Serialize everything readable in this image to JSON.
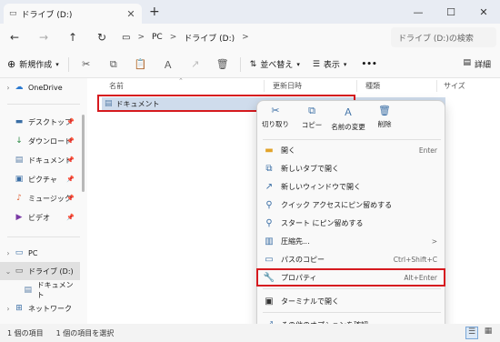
{
  "tab": {
    "title": "ドライブ (D:)",
    "close": "✕",
    "new": "+"
  },
  "window": {
    "minimize": "—",
    "maximize": "☐",
    "close": "✕"
  },
  "nav": {
    "back": "←",
    "forward": "→",
    "up": "↑",
    "refresh": "↻"
  },
  "breadcrumb": {
    "root_icon": "computer-icon",
    "items": [
      "PC",
      "ドライブ (D:)"
    ],
    "sep": ">"
  },
  "search": {
    "placeholder": "ドライブ (D:)の検索"
  },
  "toolbar": {
    "new_label": "新規作成",
    "sort_label": "並べ替え",
    "view_label": "表示",
    "more_label": "•••",
    "details_label": "詳細"
  },
  "sidebar": {
    "onedrive": "OneDrive",
    "quick": [
      "デスクトップ",
      "ダウンロード",
      "ドキュメント",
      "ピクチャ",
      "ミュージック",
      "ビデオ"
    ],
    "pc": "PC",
    "drive": "ドライブ (D:)",
    "drive_child": "ドキュメント",
    "network": "ネットワーク"
  },
  "columns": {
    "name": "名前",
    "date": "更新日時",
    "type": "種類",
    "size": "サイズ"
  },
  "files": [
    {
      "name": "ドキュメント"
    }
  ],
  "context_menu": {
    "top": {
      "cut": "切り取り",
      "copy": "コピー",
      "rename": "名前の変更",
      "delete": "削除"
    },
    "items": {
      "open": {
        "label": "開く",
        "shortcut": "Enter"
      },
      "open_tab": {
        "label": "新しいタブで開く"
      },
      "open_window": {
        "label": "新しいウィンドウで開く"
      },
      "pin_quick": {
        "label": "クイック アクセスにピン留めする"
      },
      "pin_start": {
        "label": "スタート にピン留めする"
      },
      "compress": {
        "label": "圧縮先...",
        "arrow": ">"
      },
      "copy_path": {
        "label": "パスのコピー",
        "shortcut": "Ctrl+Shift+C"
      },
      "properties": {
        "label": "プロパティ",
        "shortcut": "Alt+Enter"
      },
      "terminal": {
        "label": "ターミナルで開く"
      },
      "more_options": {
        "label": "その他のオプションを確認"
      }
    }
  },
  "status": {
    "count": "1 個の項目",
    "selected": "1 個の項目を選択"
  },
  "colors": {
    "highlight": "#d61a1f",
    "selection": "#cfdcec",
    "accent": "#3a6ea5"
  }
}
